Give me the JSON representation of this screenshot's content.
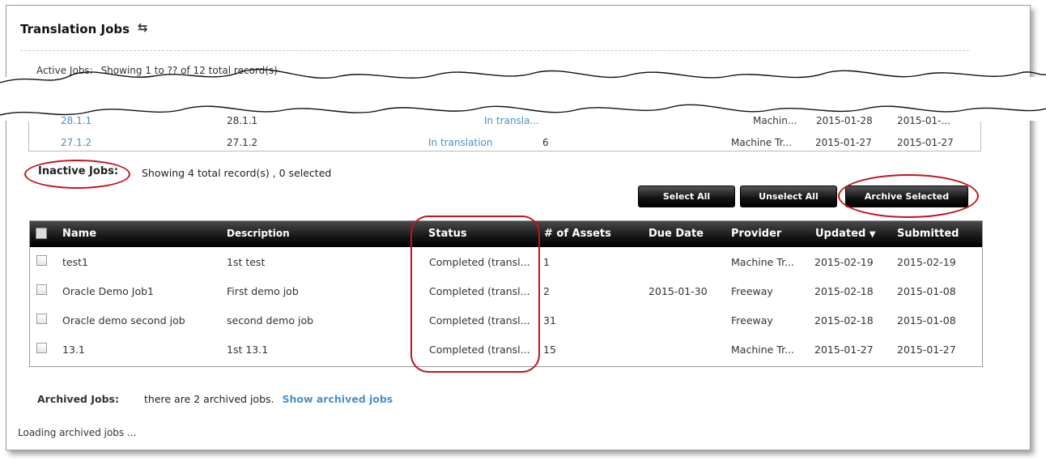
{
  "header": {
    "title": "Translation Jobs",
    "refresh_icon": "refresh-icon"
  },
  "active_jobs": {
    "label": "Active Jobs:",
    "info": "Showing 1 to ?? of 12 total record(s)"
  },
  "top_rows": [
    {
      "name": "28.1.1",
      "description": "28.1.1",
      "status": "In transla...",
      "provider": "Machin...",
      "updated": "2015-01-28",
      "submitted": "2015-01-..."
    },
    {
      "name": "27.1.2",
      "description": "27.1.2",
      "status": "In translation",
      "assets": "6",
      "provider": "Machine Tr...",
      "updated": "2015-01-27",
      "submitted": "2015-01-27"
    }
  ],
  "inactive": {
    "label": "Inactive Jobs:",
    "info": "Showing 4 total record(s) , 0 selected"
  },
  "buttons": {
    "select_all": "Select All",
    "unselect_all": "Unselect All",
    "archive_selected": "Archive Selected"
  },
  "table": {
    "headers": {
      "name": "Name",
      "description": "Description",
      "status": "Status",
      "assets": "# of Assets",
      "due": "Due Date",
      "provider": "Provider",
      "updated": "Updated",
      "submitted": "Submitted"
    },
    "sort_icon": "caret-down-icon",
    "rows": [
      {
        "name": "test1",
        "description": "1st test",
        "status": "Completed (transl...",
        "assets": "1",
        "due": "",
        "provider": "Machine Tr...",
        "updated": "2015-02-19",
        "submitted": "2015-02-19"
      },
      {
        "name": "Oracle Demo Job1",
        "description": "First demo job",
        "status": "Completed (transl...",
        "assets": "2",
        "due": "2015-01-30",
        "provider": "Freeway",
        "updated": "2015-02-18",
        "submitted": "2015-01-08"
      },
      {
        "name": "Oracle demo second job",
        "description": "second demo job",
        "status": "Completed (transl...",
        "assets": "31",
        "due": "",
        "provider": "Freeway",
        "updated": "2015-02-18",
        "submitted": "2015-01-08"
      },
      {
        "name": "13.1",
        "description": "1st 13.1",
        "status": "Completed (transl...",
        "assets": "15",
        "due": "",
        "provider": "Machine Tr...",
        "updated": "2015-01-27",
        "submitted": "2015-01-27"
      }
    ]
  },
  "archived": {
    "label": "Archived Jobs:",
    "info": "there are 2 archived jobs.",
    "link": "Show archived jobs"
  },
  "loading": "Loading archived jobs ...",
  "colors": {
    "link": "#4a90c8",
    "highlight": "#c0151b",
    "header_bg": "#1a1a1a"
  }
}
